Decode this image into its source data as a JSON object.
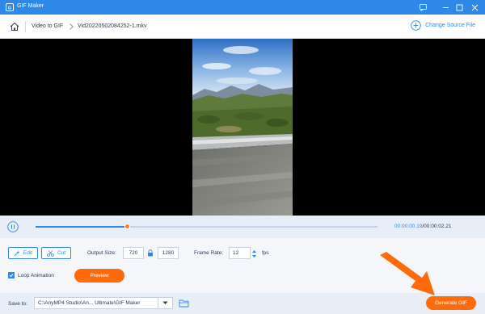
{
  "window": {
    "title": "GIF Maker",
    "accent": "#2e88e8",
    "highlight": "#ff6b0a"
  },
  "nav": {
    "breadcrumb": [
      "Video to GIF",
      "Vid20220502084252-1.mkv"
    ],
    "change_source": "Change Source File"
  },
  "playback": {
    "current_time": "00:00:00.19",
    "separator": "/",
    "total_time": "00:00:02.21",
    "progress": 0.27
  },
  "controls": {
    "edit_label": "Edit",
    "cut_label": "Cut",
    "output_size_label": "Output Size:",
    "width": "720",
    "height": "1280",
    "frame_rate_label": "Frame Rate:",
    "frame_rate": "12",
    "fps_unit": "fps",
    "loop_label": "Loop Animation",
    "loop_checked": true,
    "preview_label": "Preview"
  },
  "bottom": {
    "save_to_label": "Save to:",
    "save_path": "C:\\AnyMP4 Studio\\An... Ultimate\\GIF Maker",
    "generate_label": "Generate GIF"
  }
}
